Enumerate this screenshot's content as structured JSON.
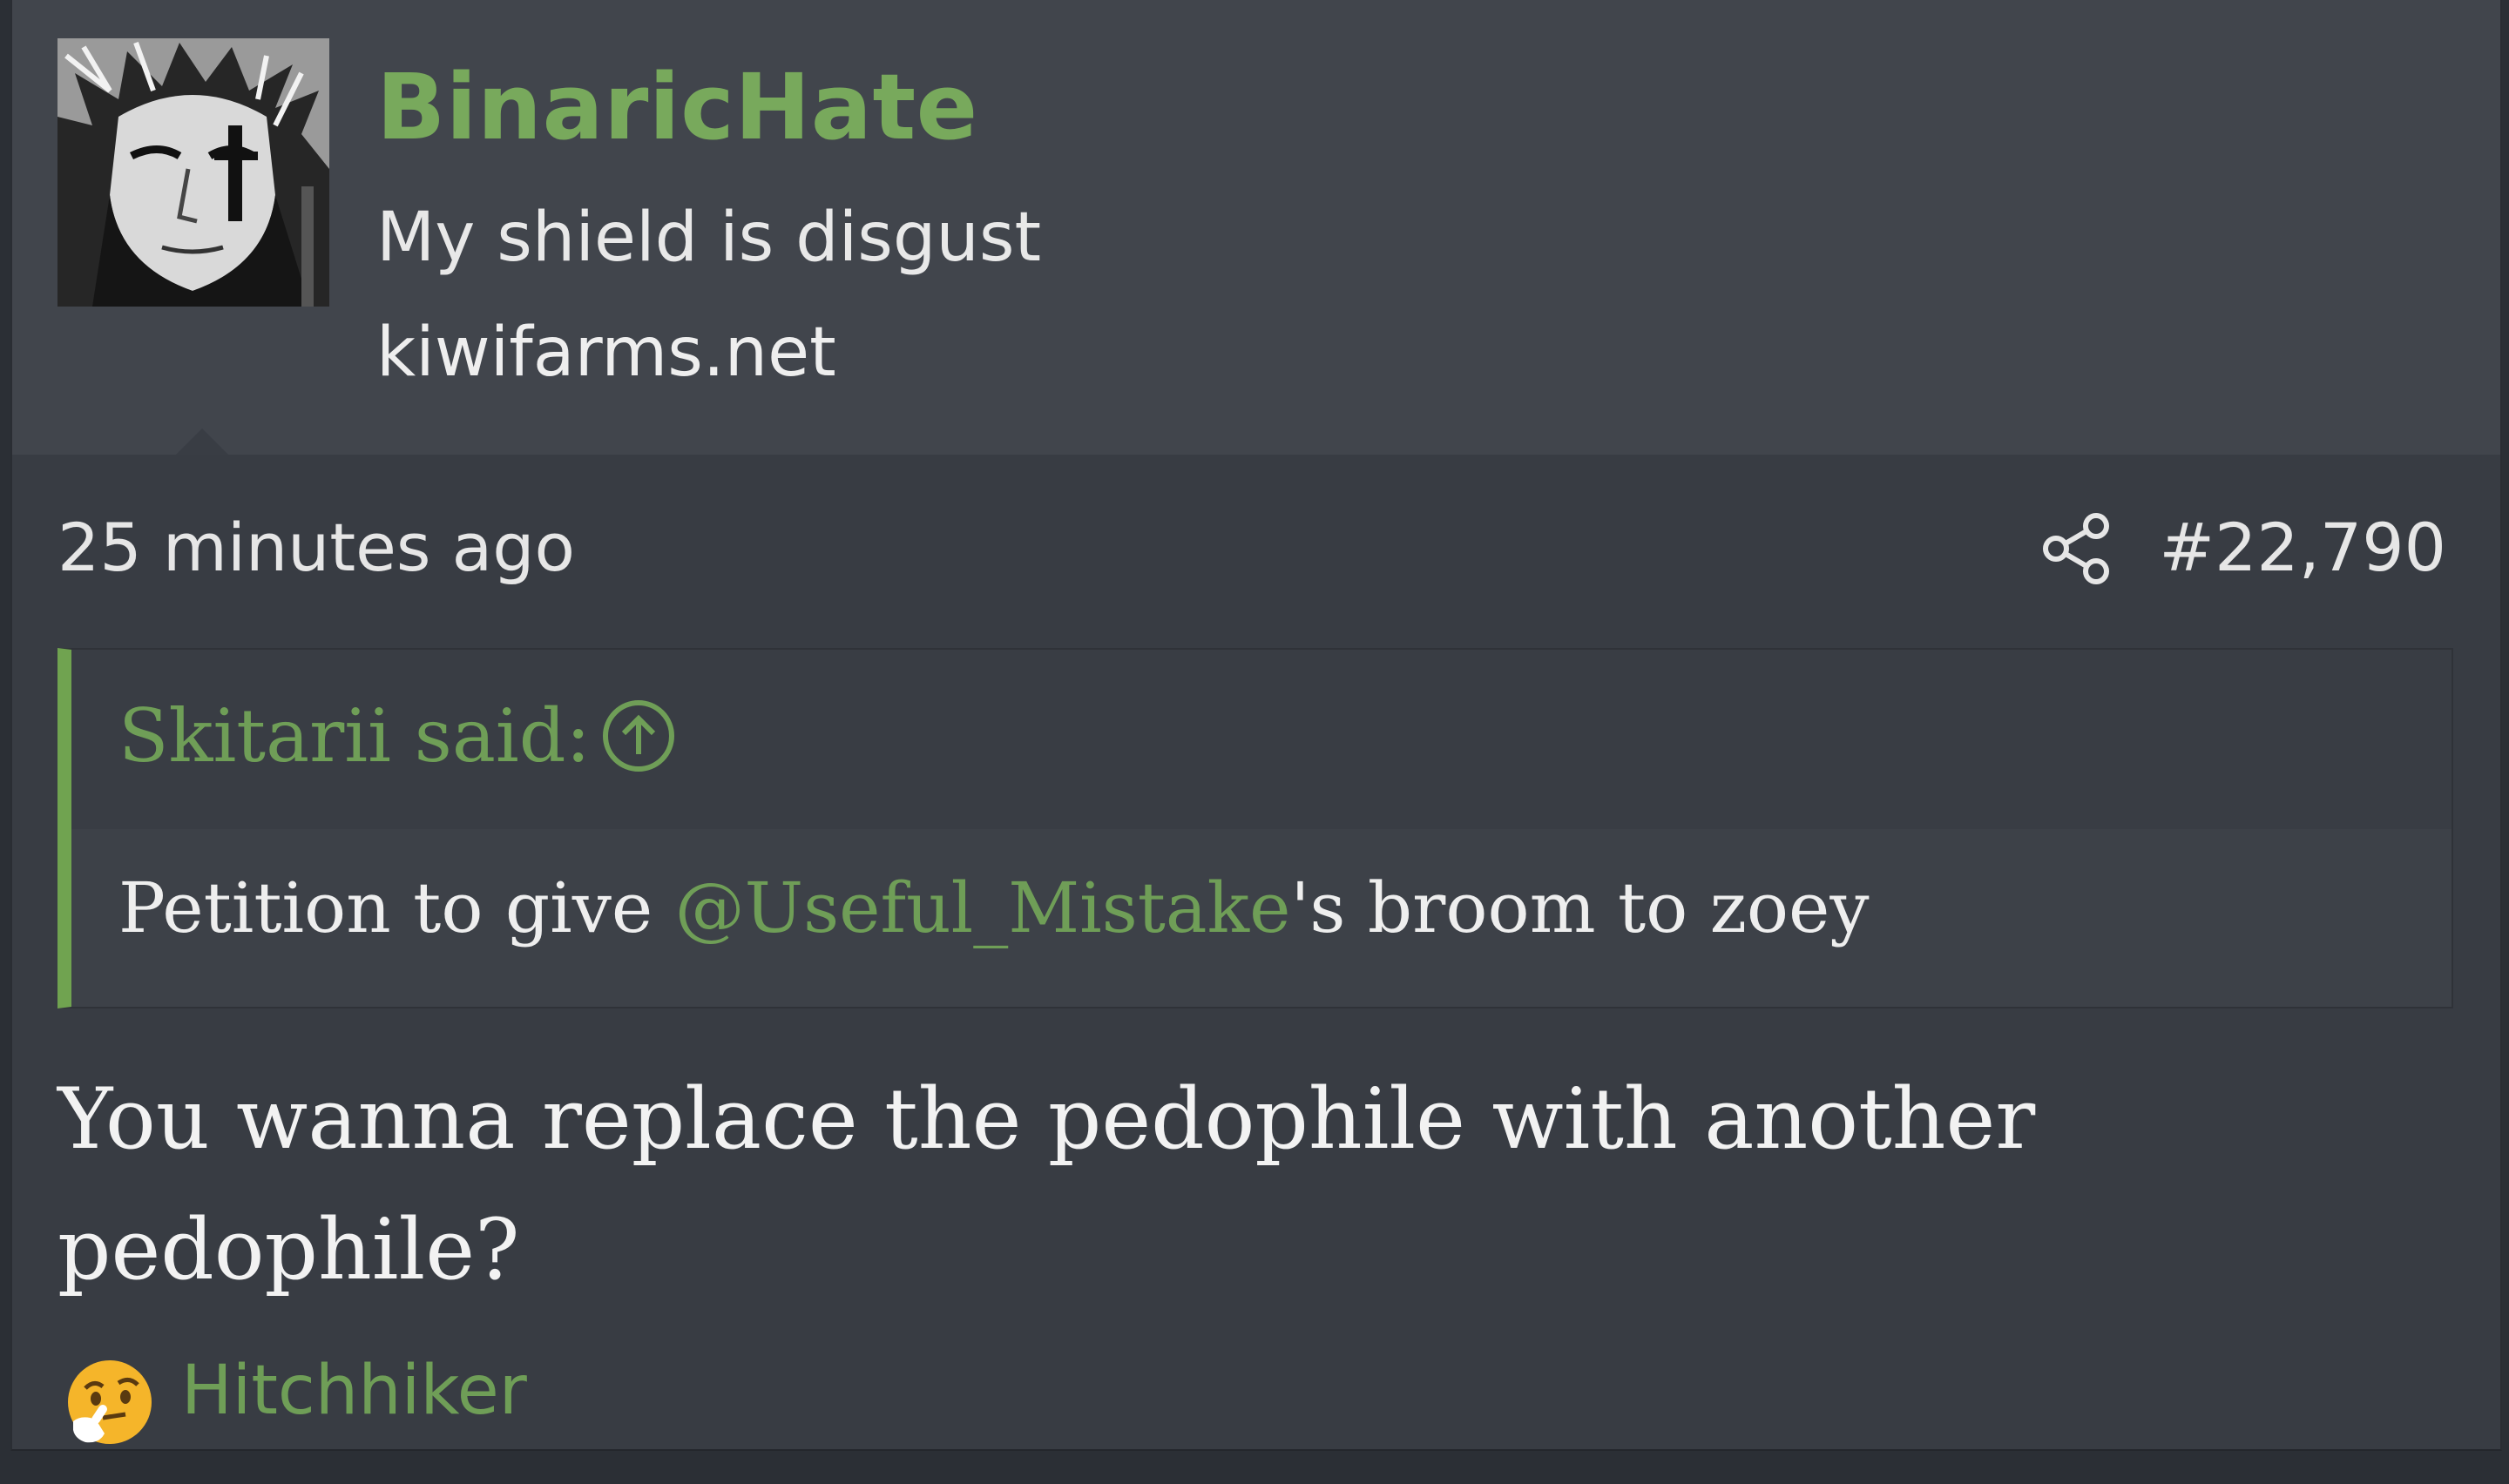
{
  "user": {
    "name": "BinaricHate",
    "title": "My shield is disgust",
    "site": "kiwifarms.net",
    "name_color": "#78a95c"
  },
  "post": {
    "time": "25 minutes ago",
    "number": "#22,790",
    "share_icon": "share-icon"
  },
  "quote": {
    "author_label": "Skitarii said:",
    "jump_icon": "arrow-up-circle-icon",
    "body_before": "Petition to give ",
    "mention": "@Useful_Mistake",
    "body_after": "'s broom to zoey",
    "accent_color": "#70a350"
  },
  "message": {
    "line1": "You wanna replace the pedophile with another",
    "line2": "pedophile?"
  },
  "reactions": {
    "emoji_icon": "thinking-face-icon",
    "text": "Hitchhiker"
  }
}
